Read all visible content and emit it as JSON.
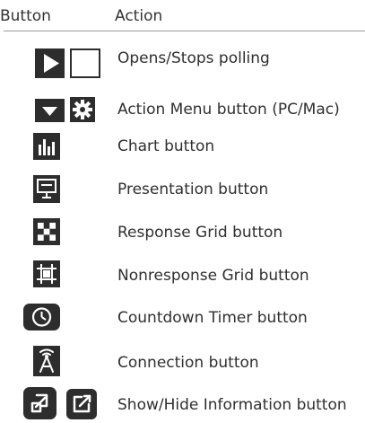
{
  "header": {
    "button_col": "Button",
    "action_col": "Action"
  },
  "rows": [
    {
      "label": "Opens/Stops polling",
      "icons": [
        "play-icon",
        "stop-icon"
      ]
    },
    {
      "label": "Action Menu button (PC/Mac)",
      "icons": [
        "dropdown-arrow-icon",
        "gear-icon"
      ]
    },
    {
      "label": "Chart button",
      "icons": [
        "bar-chart-icon"
      ]
    },
    {
      "label": "Presentation button",
      "icons": [
        "presentation-icon"
      ]
    },
    {
      "label": "Response Grid button",
      "icons": [
        "checkerboard-grid-icon"
      ]
    },
    {
      "label": "Nonresponse Grid button",
      "icons": [
        "nonresponse-grid-icon"
      ]
    },
    {
      "label": "Countdown Timer button",
      "icons": [
        "clock-icon"
      ]
    },
    {
      "label": "Connection button",
      "icons": [
        "antenna-icon"
      ]
    },
    {
      "label": "Show/Hide Information button",
      "icons": [
        "show-info-icon",
        "hide-info-icon"
      ]
    }
  ],
  "colors": {
    "icon_dark": "#2d2d2d",
    "text": "#2f2f2f",
    "rule": "#9a9a9a"
  }
}
